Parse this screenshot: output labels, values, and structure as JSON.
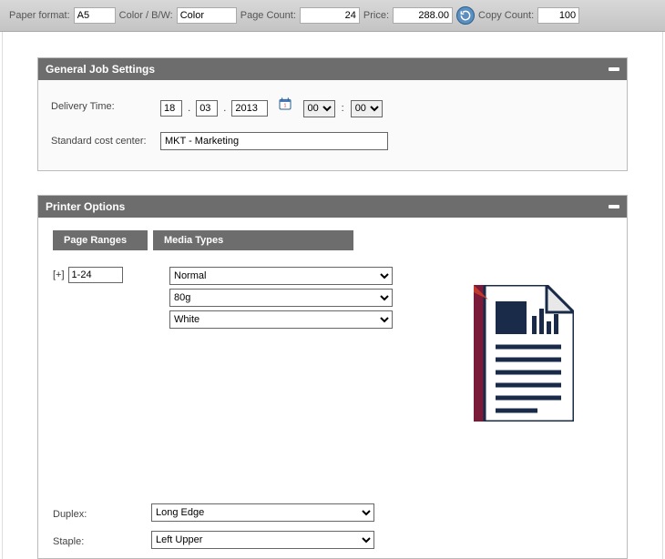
{
  "topbar": {
    "paper_format_label": "Paper format:",
    "paper_format_value": "A5",
    "color_label": "Color / B/W:",
    "color_value": "Color",
    "page_count_label": "Page Count:",
    "page_count_value": "24",
    "price_label": "Price:",
    "price_value": "288.00",
    "copy_count_label": "Copy Count:",
    "copy_count_value": "100"
  },
  "general": {
    "title": "General Job Settings",
    "delivery_label": "Delivery Time:",
    "date_day": "18",
    "date_month": "03",
    "date_year": "2013",
    "hour": "00",
    "minute": "00",
    "cost_center_label": "Standard cost center:",
    "cost_center_value": "MKT - Marketing"
  },
  "printer": {
    "title": "Printer Options",
    "tab_page_ranges": "Page Ranges",
    "tab_media_types": "Media Types",
    "plus_symbol": "[+]",
    "range_value": "1-24",
    "media_type": "Normal",
    "media_weight": "80g",
    "media_color": "White",
    "duplex_label": "Duplex:",
    "duplex_value": "Long Edge",
    "staple_label": "Staple:",
    "staple_value": "Left Upper"
  }
}
